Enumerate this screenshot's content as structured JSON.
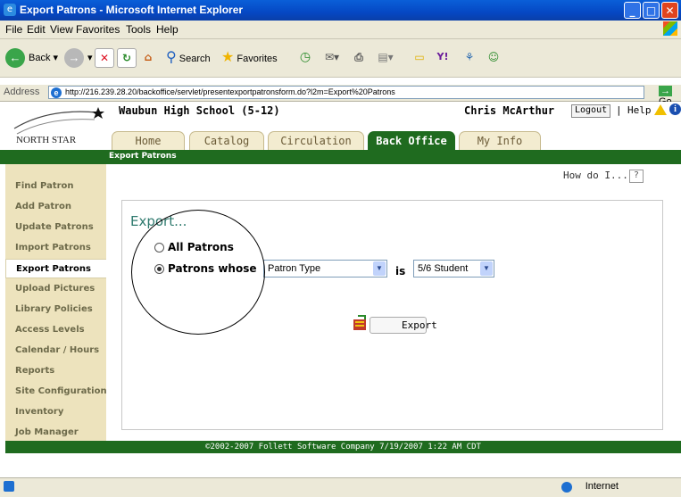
{
  "window": {
    "title": "Export Patrons - Microsoft Internet Explorer",
    "controls": [
      "minimize",
      "maximize",
      "close"
    ]
  },
  "menu": [
    "File",
    "Edit",
    "View",
    "Favorites",
    "Tools",
    "Help"
  ],
  "toolbar": {
    "back": "Back",
    "search": "Search",
    "favorites": "Favorites"
  },
  "address": {
    "label": "Address",
    "url": "http://216.239.28.20/backoffice/servlet/presentexportpatronsform.do?l2m=Export%20Patrons",
    "go": "Go",
    "links": "Link"
  },
  "header": {
    "school": "Waubun High School (5-12)",
    "user": "Chris McArthur",
    "logout": "Logout",
    "separator": "|",
    "help": "Help"
  },
  "tabs": [
    {
      "label": "Home",
      "active": false
    },
    {
      "label": "Catalog",
      "active": false
    },
    {
      "label": "Circulation",
      "active": false
    },
    {
      "label": "Back Office",
      "active": true
    },
    {
      "label": "My Info",
      "active": false
    }
  ],
  "breadcrumb": "Export Patrons",
  "sidebar": [
    "Find Patron",
    "Add Patron",
    "Update Patrons",
    "Import Patrons",
    "Export Patrons",
    "Upload Pictures",
    "Library Policies",
    "Access Levels",
    "Calendar / Hours",
    "Reports",
    "Site Configuration",
    "Inventory",
    "Job Manager"
  ],
  "sidebar_active": "Export Patrons",
  "main": {
    "howdoi": "How do I...",
    "help_q": "?",
    "export_title": "Export...",
    "option_all": "All Patrons",
    "option_whose": "Patrons whose",
    "field_select": "Patron Type",
    "is_label": "is",
    "value_select": "5/6 Student",
    "export_button": "Export"
  },
  "footer": "©2002-2007  Follett Software Company    7/19/2007 1:22 AM CDT",
  "status": {
    "zone": "Internet"
  },
  "colors": {
    "green": "#1f6b1f",
    "sidebar_bg": "#ede3bd",
    "xp_blue": "#0548c4"
  }
}
